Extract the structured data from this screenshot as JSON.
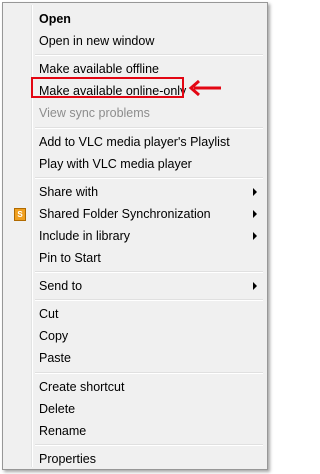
{
  "menu": {
    "items": [
      {
        "label": "Open",
        "bold": true
      },
      {
        "label": "Open in new window"
      },
      {
        "label": "Make available offline"
      },
      {
        "label": "Make available online-only"
      },
      {
        "label": "View sync problems",
        "disabled": true
      },
      {
        "label": "Add to VLC media player's Playlist"
      },
      {
        "label": "Play with VLC media player"
      },
      {
        "label": "Share with",
        "submenu": true
      },
      {
        "label": "Shared Folder Synchronization",
        "submenu": true,
        "icon": "sync-folder-icon"
      },
      {
        "label": "Include in library",
        "submenu": true
      },
      {
        "label": "Pin to Start"
      },
      {
        "label": "Send to",
        "submenu": true
      },
      {
        "label": "Cut"
      },
      {
        "label": "Copy"
      },
      {
        "label": "Paste"
      },
      {
        "label": "Create shortcut"
      },
      {
        "label": "Delete"
      },
      {
        "label": "Rename"
      },
      {
        "label": "Properties"
      }
    ]
  },
  "annotation": {
    "highlight_color": "#e30613",
    "icon": "red-left-arrow-icon"
  }
}
